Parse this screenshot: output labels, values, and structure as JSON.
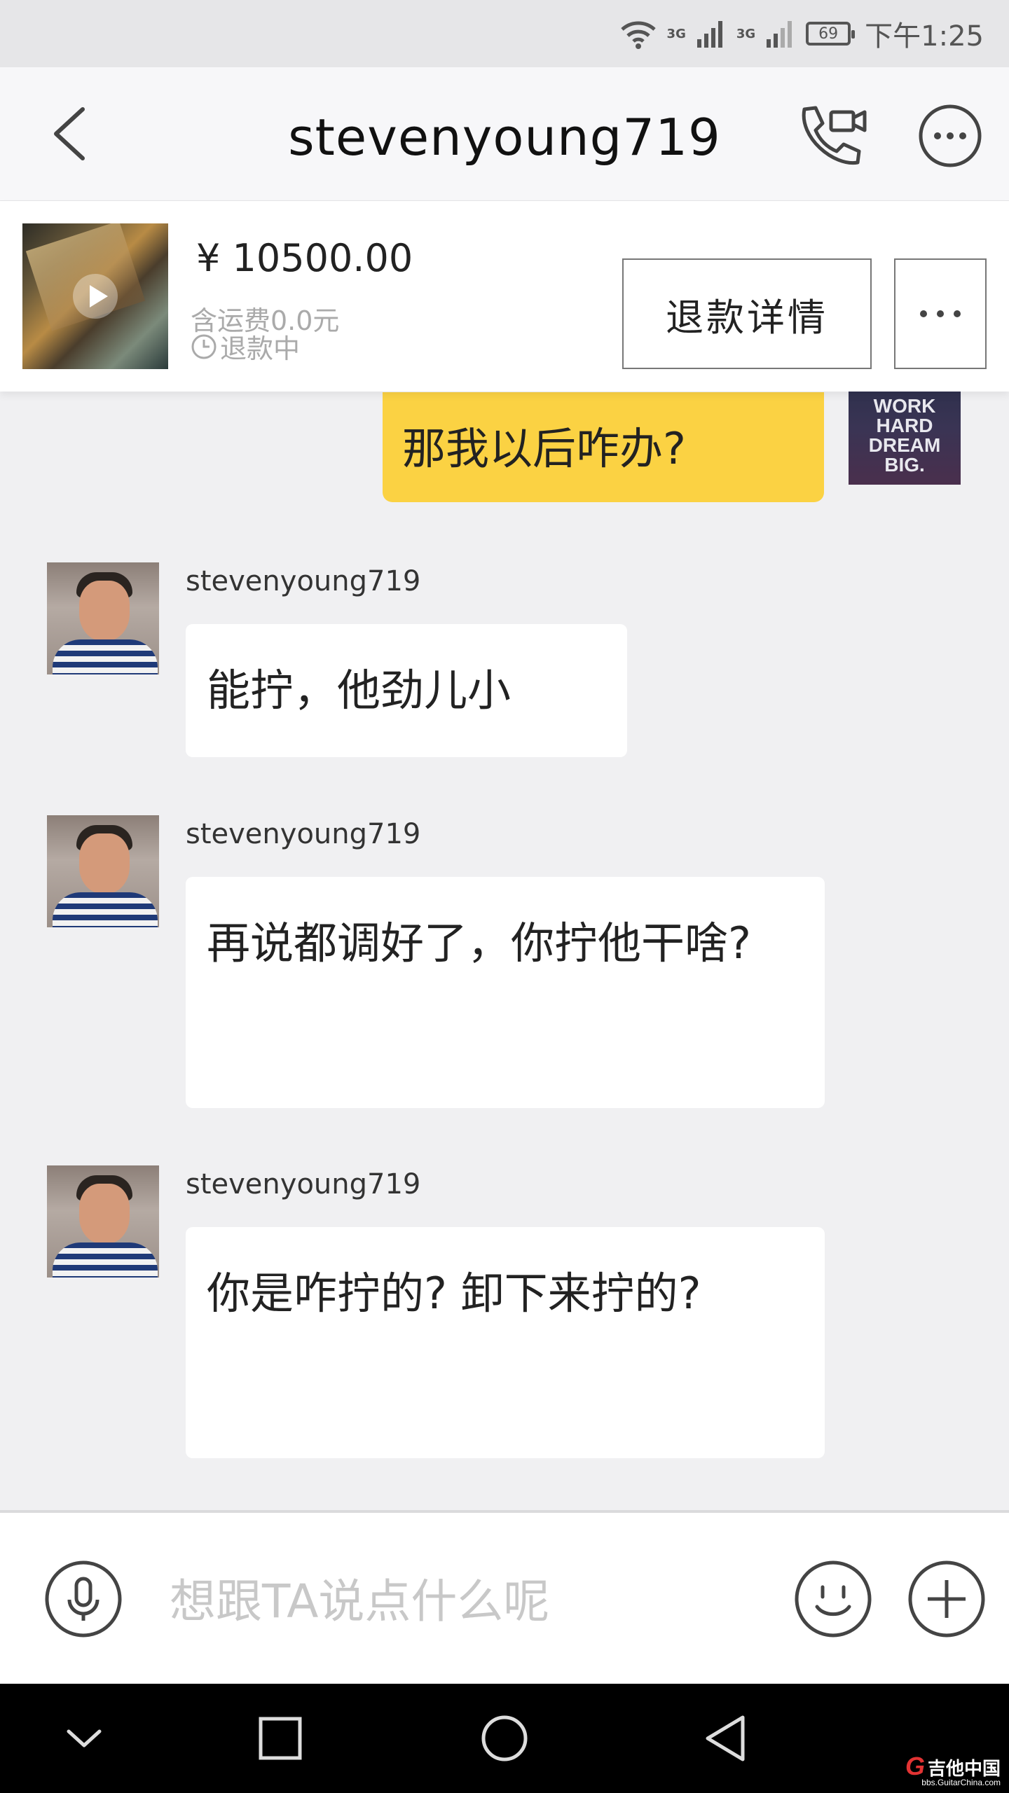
{
  "status_bar": {
    "network_1": "3G",
    "network_2": "3G",
    "battery": "69",
    "time": "下午1:25"
  },
  "header": {
    "title": "stevenyoung719",
    "icons": [
      "back-arrow-icon",
      "video-call-icon",
      "more-icon"
    ]
  },
  "order": {
    "price": "¥  10500.00",
    "shipping": "含运费0.0元",
    "status": "退款中",
    "refund_button": "退款详情"
  },
  "my_message": {
    "text": "那我以后咋办?",
    "avatar_text": [
      "WORK",
      "HARD",
      "DREAM",
      "BIG."
    ]
  },
  "messages": [
    {
      "sender": "stevenyoung719",
      "text": "能拧，他劲儿小"
    },
    {
      "sender": "stevenyoung719",
      "text": "再说都调好了，你拧他干啥?"
    },
    {
      "sender": "stevenyoung719",
      "text": "你是咋拧的? 卸下来拧的?"
    }
  ],
  "input": {
    "placeholder": "想跟TA说点什么呢"
  },
  "watermark": {
    "site": "吉他中国",
    "url": "bbs.GuitarChina.com"
  },
  "colors": {
    "my_bubble": "#fbd243",
    "background": "#f0f0f2",
    "bubble": "#ffffff"
  }
}
